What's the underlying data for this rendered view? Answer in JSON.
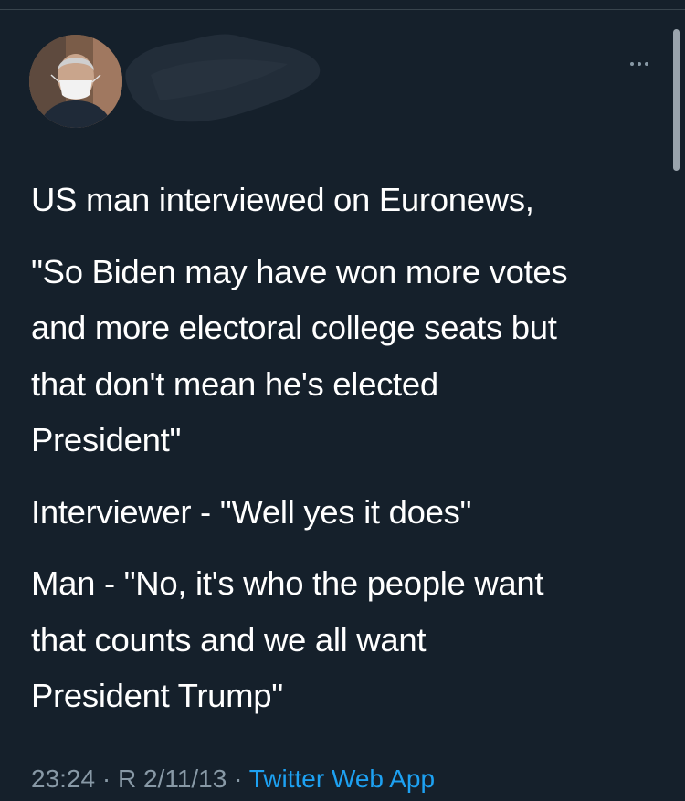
{
  "header": {
    "more_icon": "more-horizontal-icon"
  },
  "tweet": {
    "paragraphs": [
      "US man interviewed on Euronews,",
      "\"So Biden may have won more votes\nand more electoral college seats but\nthat don't mean he's elected\nPresident\"",
      "Interviewer -  \"Well yes it does\"",
      "Man - \"No, it's who the people want\nthat counts and we all want\nPresident Trump\""
    ]
  },
  "meta": {
    "time": "23:24",
    "separator": " · ",
    "date": "R 2/11/13",
    "source": "Twitter Web App"
  },
  "colors": {
    "background": "#15202b",
    "text": "#ffffff",
    "muted": "#8899a6",
    "link": "#1da1f2"
  }
}
